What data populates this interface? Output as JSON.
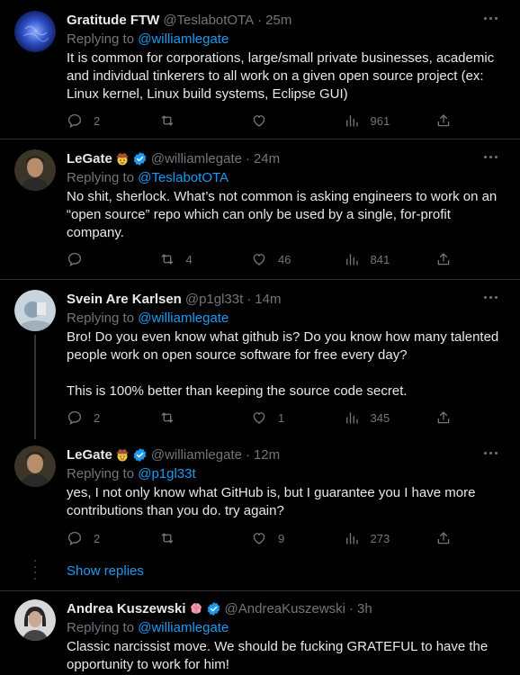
{
  "tweets": [
    {
      "name": "Gratitude FTW",
      "handle": "@TeslabotOTA",
      "time": "25m",
      "replying_label": "Replying to",
      "replying_to": "@williamlegate",
      "text": [
        "It is common for corporations, large/small private businesses, academic and individual tinkerers to all work on a given open source project (ex: Linux kernel, Linux build systems, Eclipse GUI)"
      ],
      "replies": "2",
      "retweets": "",
      "likes": "",
      "views": "961"
    },
    {
      "name": "LeGate",
      "handle": "@williamlegate",
      "time": "24m",
      "replying_label": "Replying to",
      "replying_to": "@TeslabotOTA",
      "text": [
        "No shit, sherlock. What’s not common is asking engineers to work on an “open source” repo which can only be used by a single, for-profit company."
      ],
      "replies": "",
      "retweets": "4",
      "likes": "46",
      "views": "841"
    },
    {
      "name": "Svein Are Karlsen",
      "handle": "@p1gl33t",
      "time": "14m",
      "replying_label": "Replying to",
      "replying_to": "@williamlegate",
      "text": [
        "Bro! Do you even know what github is? Do you know how many talented people work on open source software for free every day?",
        "This is 100% better than keeping the source code secret."
      ],
      "replies": "2",
      "retweets": "",
      "likes": "1",
      "views": "345"
    },
    {
      "name": "LeGate",
      "handle": "@williamlegate",
      "time": "12m",
      "replying_label": "Replying to",
      "replying_to": "@p1gl33t",
      "text": [
        "yes, I not only know what GitHub is, but I guarantee you I have more contributions than you do. try again?"
      ],
      "replies": "2",
      "retweets": "",
      "likes": "9",
      "views": "273"
    },
    {
      "name": "Andrea Kuszewski",
      "handle": "@AndreaKuszewski",
      "time": "3h",
      "replying_label": "Replying to",
      "replying_to": "@williamlegate",
      "text": [
        "Classic narcissist move. We should be fucking GRATEFUL to have  the opportunity to work for him!"
      ]
    }
  ],
  "show_replies": "Show replies",
  "colors": {
    "background": "#000000",
    "text": "#e7e9ea",
    "muted": "#71767b",
    "link": "#1d9bf0",
    "verified": "#1d9bf0",
    "divider": "#2f3336"
  }
}
